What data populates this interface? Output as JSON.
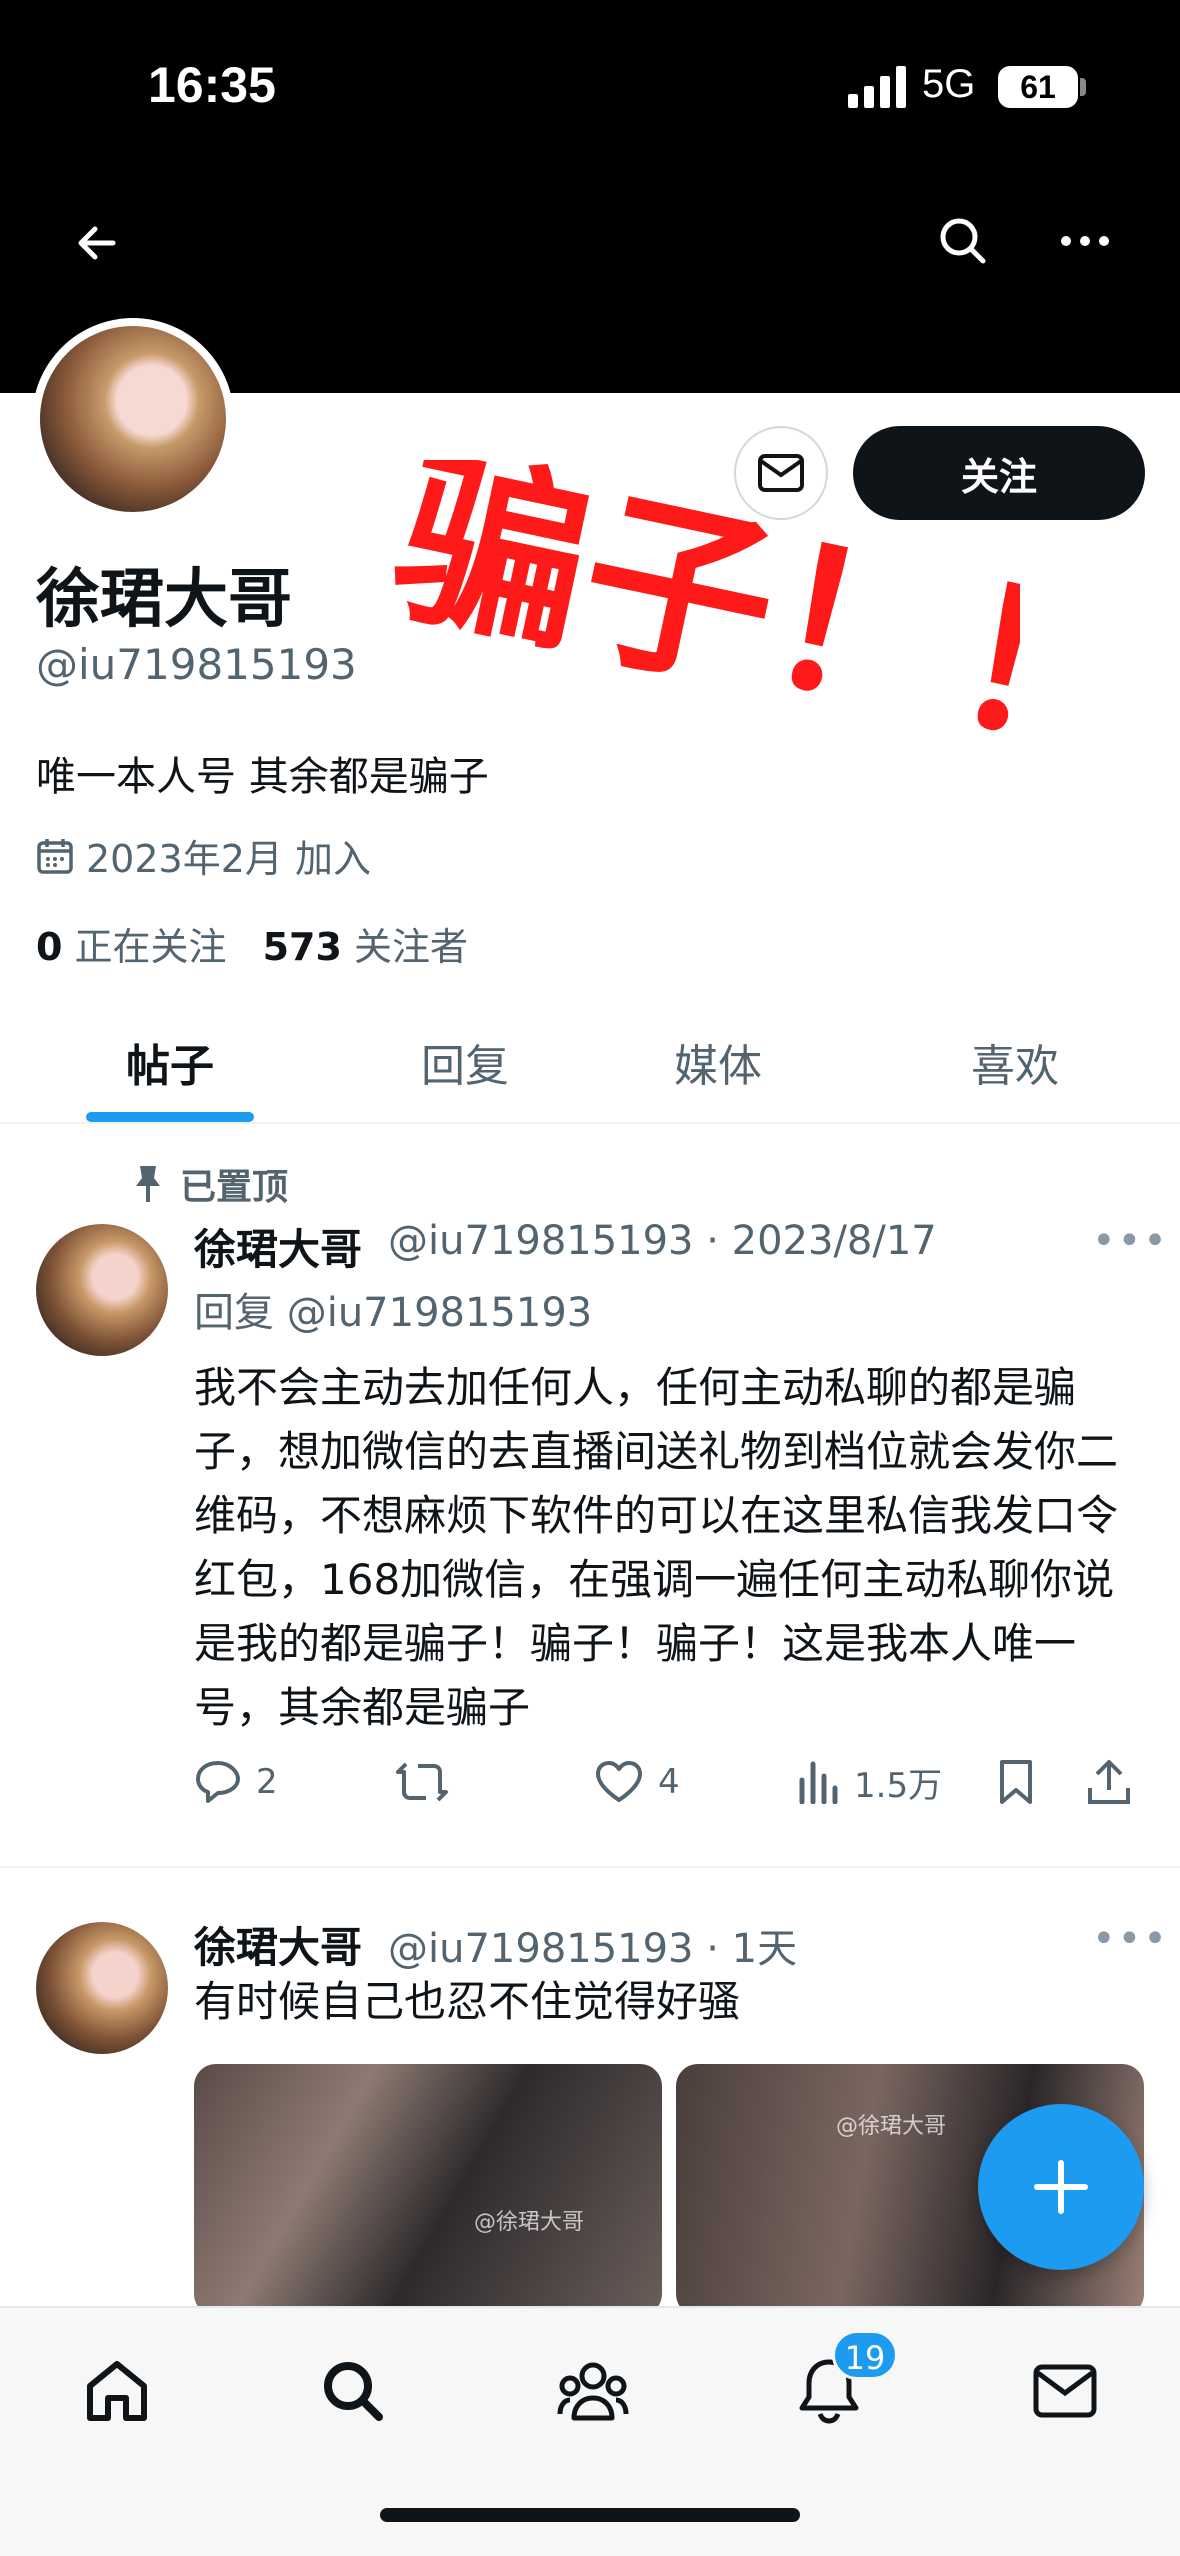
{
  "status_bar": {
    "time": "16:35",
    "network": "5G",
    "battery": "61"
  },
  "profile": {
    "display_name": "徐珺大哥",
    "handle": "@iu719815193",
    "bio": "唯一本人号 其余都是骗子",
    "joined": "2023年2月 加入",
    "following_count": "0",
    "following_label": "正在关注",
    "followers_count": "573",
    "followers_label": "关注者",
    "follow_label": "关注",
    "stamp_text": "骗子！！"
  },
  "tabs": [
    {
      "label": "帖子",
      "active": true
    },
    {
      "label": "回复",
      "active": false
    },
    {
      "label": "媒体",
      "active": false
    },
    {
      "label": "喜欢",
      "active": false
    }
  ],
  "pinned": {
    "label": "已置顶",
    "name": "徐珺大哥",
    "meta": "@iu719815193 · 2023/8/17",
    "reply_to": "回复 @iu719815193",
    "text": "我不会主动去加任何人，任何主动私聊的都是骗子，想加微信的去直播间送礼物到档位就会发你二维码，不想麻烦下软件的可以在这里私信我发口令红包，168加微信，在强调一遍任何主动私聊你说是我的都是骗子！骗子！骗子！这是我本人唯一号，其余都是骗子",
    "replies": "2",
    "likes": "4",
    "views": "1.5万"
  },
  "post2": {
    "name": "徐珺大哥",
    "meta": "@iu719815193 · 1天",
    "text": "有时候自己也忍不住觉得好骚",
    "watermark": "@徐珺大哥"
  },
  "notifications_badge": "19",
  "colors": {
    "accent": "#1d9bf0",
    "stamp": "#ff1a1a",
    "text": "#0f1419",
    "muted": "#536471"
  }
}
